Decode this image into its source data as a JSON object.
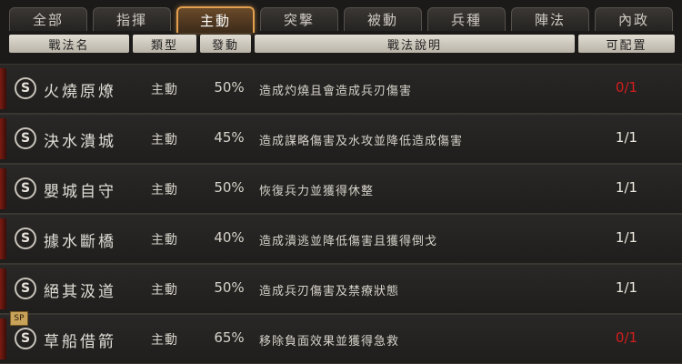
{
  "tabs": [
    {
      "label": "全部"
    },
    {
      "label": "指揮"
    },
    {
      "label": "主動"
    },
    {
      "label": "突撃"
    },
    {
      "label": "被動"
    },
    {
      "label": "兵種"
    },
    {
      "label": "陣法"
    },
    {
      "label": "內政"
    }
  ],
  "active_tab": "主動",
  "columns": {
    "name": "戰法名",
    "type": "類型",
    "rate": "發動",
    "desc": "戰法說明",
    "config": "可配置"
  },
  "rows": [
    {
      "icon": "S",
      "name": "火燒原燎",
      "type": "主動",
      "rate": "50%",
      "desc": "造成灼燒且會造成兵刃傷害",
      "config": "0/1",
      "config_color": "#d21e1e"
    },
    {
      "icon": "S",
      "name": "決水潰城",
      "type": "主動",
      "rate": "45%",
      "desc": "造成謀略傷害及水攻並降低造成傷害",
      "config": "1/1",
      "config_color": "#ece8e0"
    },
    {
      "icon": "S",
      "name": "嬰城自守",
      "type": "主動",
      "rate": "50%",
      "desc": "恢復兵力並獲得休整",
      "config": "1/1",
      "config_color": "#ece8e0"
    },
    {
      "icon": "S",
      "name": "據水斷橋",
      "type": "主動",
      "rate": "40%",
      "desc": "造成潰逃並降低傷害且獲得倒戈",
      "config": "1/1",
      "config_color": "#ece8e0"
    },
    {
      "icon": "S",
      "name": "絕其汲道",
      "type": "主動",
      "rate": "50%",
      "desc": "造成兵刃傷害及禁療狀態",
      "config": "1/1",
      "config_color": "#ece8e0"
    },
    {
      "icon": "S",
      "name": "草船借箭",
      "type": "主動",
      "rate": "65%",
      "desc": "移除負面效果並獲得急救",
      "config": "0/1",
      "config_color": "#d21e1e",
      "tag": "SP"
    }
  ]
}
